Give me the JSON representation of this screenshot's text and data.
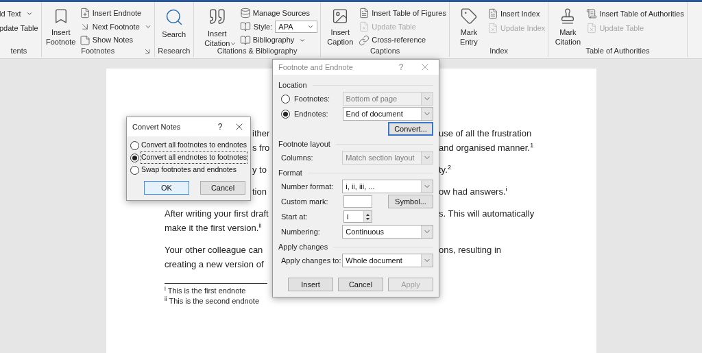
{
  "ribbon": {
    "groups": [
      {
        "label": "tents",
        "launcher": false,
        "items": [
          {
            "kind": "small",
            "label": "ld Text",
            "dropdown": true,
            "disabled": false
          },
          {
            "kind": "small",
            "label": "pdate Table",
            "dropdown": false,
            "disabled": false
          }
        ]
      },
      {
        "label": "Footnotes",
        "launcher": true,
        "items": [
          {
            "kind": "large",
            "label": "Insert Footnote",
            "dropdown": false,
            "disabled": false
          },
          {
            "kind": "small",
            "label": "Insert Endnote",
            "dropdown": false,
            "disabled": false
          },
          {
            "kind": "small",
            "label": "Next Footnote",
            "dropdown": true,
            "disabled": false
          },
          {
            "kind": "small",
            "label": "Show Notes",
            "dropdown": false,
            "disabled": false
          }
        ]
      },
      {
        "label": "Research",
        "launcher": false,
        "items": [
          {
            "kind": "large",
            "label": "Search",
            "dropdown": false,
            "disabled": false
          }
        ]
      },
      {
        "label": "Citations & Bibliography",
        "launcher": false,
        "items": [
          {
            "kind": "large",
            "label": "Insert Citation",
            "dropdown": true,
            "disabled": false
          },
          {
            "kind": "small",
            "label": "Manage Sources",
            "dropdown": false,
            "disabled": false
          },
          {
            "kind": "style",
            "label": "Style:",
            "value": "APA",
            "dropdown": true,
            "disabled": false
          },
          {
            "kind": "small",
            "label": "Bibliography",
            "dropdown": true,
            "disabled": false
          }
        ]
      },
      {
        "label": "Captions",
        "launcher": false,
        "items": [
          {
            "kind": "large",
            "label": "Insert Caption",
            "dropdown": false,
            "disabled": false
          },
          {
            "kind": "small",
            "label": "Insert Table of Figures",
            "dropdown": false,
            "disabled": false
          },
          {
            "kind": "small",
            "label": "Update Table",
            "dropdown": false,
            "disabled": true
          },
          {
            "kind": "small",
            "label": "Cross-reference",
            "dropdown": false,
            "disabled": false
          }
        ]
      },
      {
        "label": "Index",
        "launcher": false,
        "items": [
          {
            "kind": "large",
            "label": "Mark Entry",
            "dropdown": false,
            "disabled": false
          },
          {
            "kind": "small",
            "label": "Insert Index",
            "dropdown": false,
            "disabled": false
          },
          {
            "kind": "small",
            "label": "Update Index",
            "dropdown": false,
            "disabled": true
          }
        ]
      },
      {
        "label": "Table of Authorities",
        "launcher": false,
        "items": [
          {
            "kind": "large",
            "label": "Mark Citation",
            "dropdown": false,
            "disabled": false
          },
          {
            "kind": "small",
            "label": "Insert Table of Authorities",
            "dropdown": false,
            "disabled": false
          },
          {
            "kind": "small",
            "label": "Update Table",
            "dropdown": false,
            "disabled": true
          }
        ]
      }
    ]
  },
  "document": {
    "paragraphs": [
      {
        "lines": [
          {
            "left": "ither",
            "right": "use of all the frustration",
            "covered_left": true
          },
          {
            "left": "s fro",
            "right": "and organised manner.$^{1}$",
            "covered_left": true
          }
        ]
      },
      {
        "lines": [
          {
            "left": "y to",
            "right": "ty.$^{2}$",
            "covered_left": true
          }
        ]
      },
      {
        "lines": [
          {
            "left": "tion",
            "right": "ow had answers.$^{i}$",
            "covered_left": true
          }
        ]
      },
      {
        "lines": [
          {
            "left": "After writing your first draft",
            "right": "s. This will automatically",
            "covered_left": false
          },
          {
            "left": "make it the first version.$^{ii}$",
            "covered_left": false
          }
        ]
      },
      {
        "lines": [
          {
            "left": "Your other colleague can",
            "right": "ons, resulting in",
            "covered_left": false
          },
          {
            "left": "creating a new version of",
            "covered_left": false
          }
        ]
      }
    ],
    "endnotes": [
      "$^{i}$ This is the first endnote",
      "$^{ii}$ This is the second endnote"
    ]
  },
  "footnote_dialog": {
    "title": "Footnote and Endnote",
    "help": "?",
    "sections": [
      {
        "title": "Location",
        "rows": [
          {
            "kind": "radio_select",
            "label": "Footnotes:",
            "selected": false,
            "value": "Bottom of page",
            "disabled": true
          },
          {
            "kind": "radio_select",
            "label": "Endnotes:",
            "selected": true,
            "value": "End of document",
            "disabled": false
          },
          {
            "kind": "button",
            "label": "Convert...",
            "focused": true
          }
        ]
      },
      {
        "title": "Footnote layout",
        "rows": [
          {
            "kind": "select",
            "label": "Columns:",
            "value": "Match section layout",
            "disabled": true
          }
        ]
      },
      {
        "title": "Format",
        "rows": [
          {
            "kind": "select",
            "label": "Number format:",
            "value": "i, ii, iii, ...",
            "disabled": false
          },
          {
            "kind": "text",
            "label": "Custom mark:",
            "button": "Symbol..."
          },
          {
            "kind": "spin",
            "label": "Start at:",
            "value": "i"
          },
          {
            "kind": "select",
            "label": "Numbering:",
            "value": "Continuous",
            "disabled": false
          }
        ]
      },
      {
        "title": "Apply changes",
        "rows": [
          {
            "kind": "select",
            "label": "Apply changes to:",
            "value": "Whole document",
            "disabled": false
          }
        ]
      }
    ],
    "buttons": [
      {
        "label": "Insert",
        "disabled": false
      },
      {
        "label": "Cancel",
        "disabled": false
      },
      {
        "label": "Apply",
        "disabled": true
      }
    ]
  },
  "convert_dialog": {
    "title": "Convert Notes",
    "help": "?",
    "options": [
      {
        "label": "Convert all footnotes to endnotes",
        "selected": false
      },
      {
        "label": "Convert all endnotes to footnotes",
        "selected": true
      },
      {
        "label": "Swap footnotes and endnotes",
        "selected": false
      }
    ],
    "buttons": [
      {
        "label": "OK",
        "focused": true
      },
      {
        "label": "Cancel",
        "focused": false
      }
    ]
  }
}
